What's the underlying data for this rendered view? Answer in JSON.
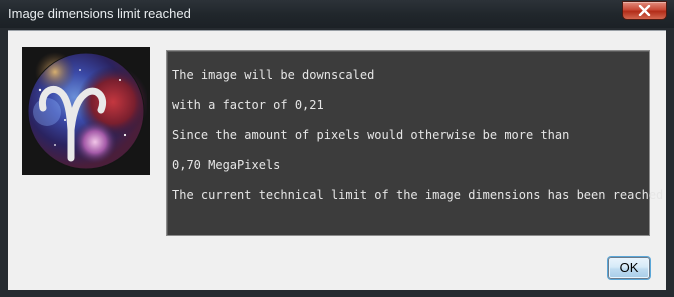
{
  "window": {
    "title": "Image dimensions limit reached"
  },
  "icons": {
    "close": "close-icon",
    "logo": "aries-nebula-logo"
  },
  "message": {
    "lines": [
      "The image will be downscaled",
      "with a factor of 0,21",
      "Since the amount of pixels would otherwise be more than",
      "0,70 MegaPixels",
      "The current technical limit of the image dimensions has been reached"
    ]
  },
  "buttons": {
    "ok_label": "OK"
  },
  "colors": {
    "titlebar": "#262b30",
    "close_button": "#c94a37",
    "message_background": "#3c3c3c",
    "message_text": "#e6e6e6",
    "dialog_body": "#f0f0f0"
  }
}
